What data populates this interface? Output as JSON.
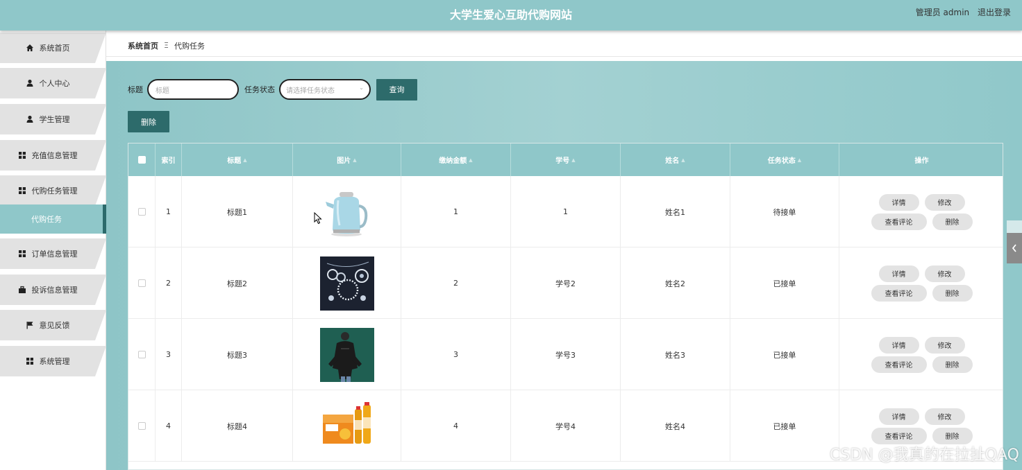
{
  "header": {
    "title": "大学生爱心互助代购网站",
    "user_label": "管理员 admin",
    "logout_label": "退出登录"
  },
  "sidebar": {
    "items": [
      {
        "label": "系统首页",
        "icon": "home-icon"
      },
      {
        "label": "个人中心",
        "icon": "user-icon"
      },
      {
        "label": "学生管理",
        "icon": "user-icon"
      },
      {
        "label": "充值信息管理",
        "icon": "grid-icon"
      },
      {
        "label": "代购任务管理",
        "icon": "grid-icon"
      },
      {
        "label": "订单信息管理",
        "icon": "grid-icon"
      },
      {
        "label": "投诉信息管理",
        "icon": "briefcase-icon"
      },
      {
        "label": "意见反馈",
        "icon": "flag-icon"
      },
      {
        "label": "系统管理",
        "icon": "grid-icon"
      }
    ],
    "active_submenu": "代购任务"
  },
  "breadcrumb": {
    "home": "系统首页",
    "separator": "Ξ",
    "current": "代购任务"
  },
  "search": {
    "title_label": "标题",
    "title_placeholder": "标题",
    "status_label": "任务状态",
    "status_placeholder": "请选择任务状态",
    "query_button": "查询"
  },
  "actions": {
    "delete_button": "删除"
  },
  "table": {
    "columns": [
      "索引",
      "标题",
      "图片",
      "缴纳金额",
      "学号",
      "姓名",
      "任务状态",
      "操作"
    ],
    "rows": [
      {
        "index": "1",
        "title": "标题1",
        "image": "kettle",
        "amount": "1",
        "student_id": "1",
        "name": "姓名1",
        "status": "待接单"
      },
      {
        "index": "2",
        "title": "标题2",
        "image": "jewelry",
        "amount": "2",
        "student_id": "学号2",
        "name": "姓名2",
        "status": "已接单"
      },
      {
        "index": "3",
        "title": "标题3",
        "image": "jacket",
        "amount": "3",
        "student_id": "学号3",
        "name": "姓名3",
        "status": "已接单"
      },
      {
        "index": "4",
        "title": "标题4",
        "image": "juice",
        "amount": "4",
        "student_id": "学号4",
        "name": "姓名4",
        "status": "已接单"
      }
    ],
    "row_actions": {
      "detail": "详情",
      "edit": "修改",
      "comments": "查看评论",
      "delete": "删除"
    }
  },
  "watermark": "CSDN @我真的在拉扯QAQ",
  "colors": {
    "accent": "#8fc7c9",
    "dark_button": "#2d6b6b"
  }
}
